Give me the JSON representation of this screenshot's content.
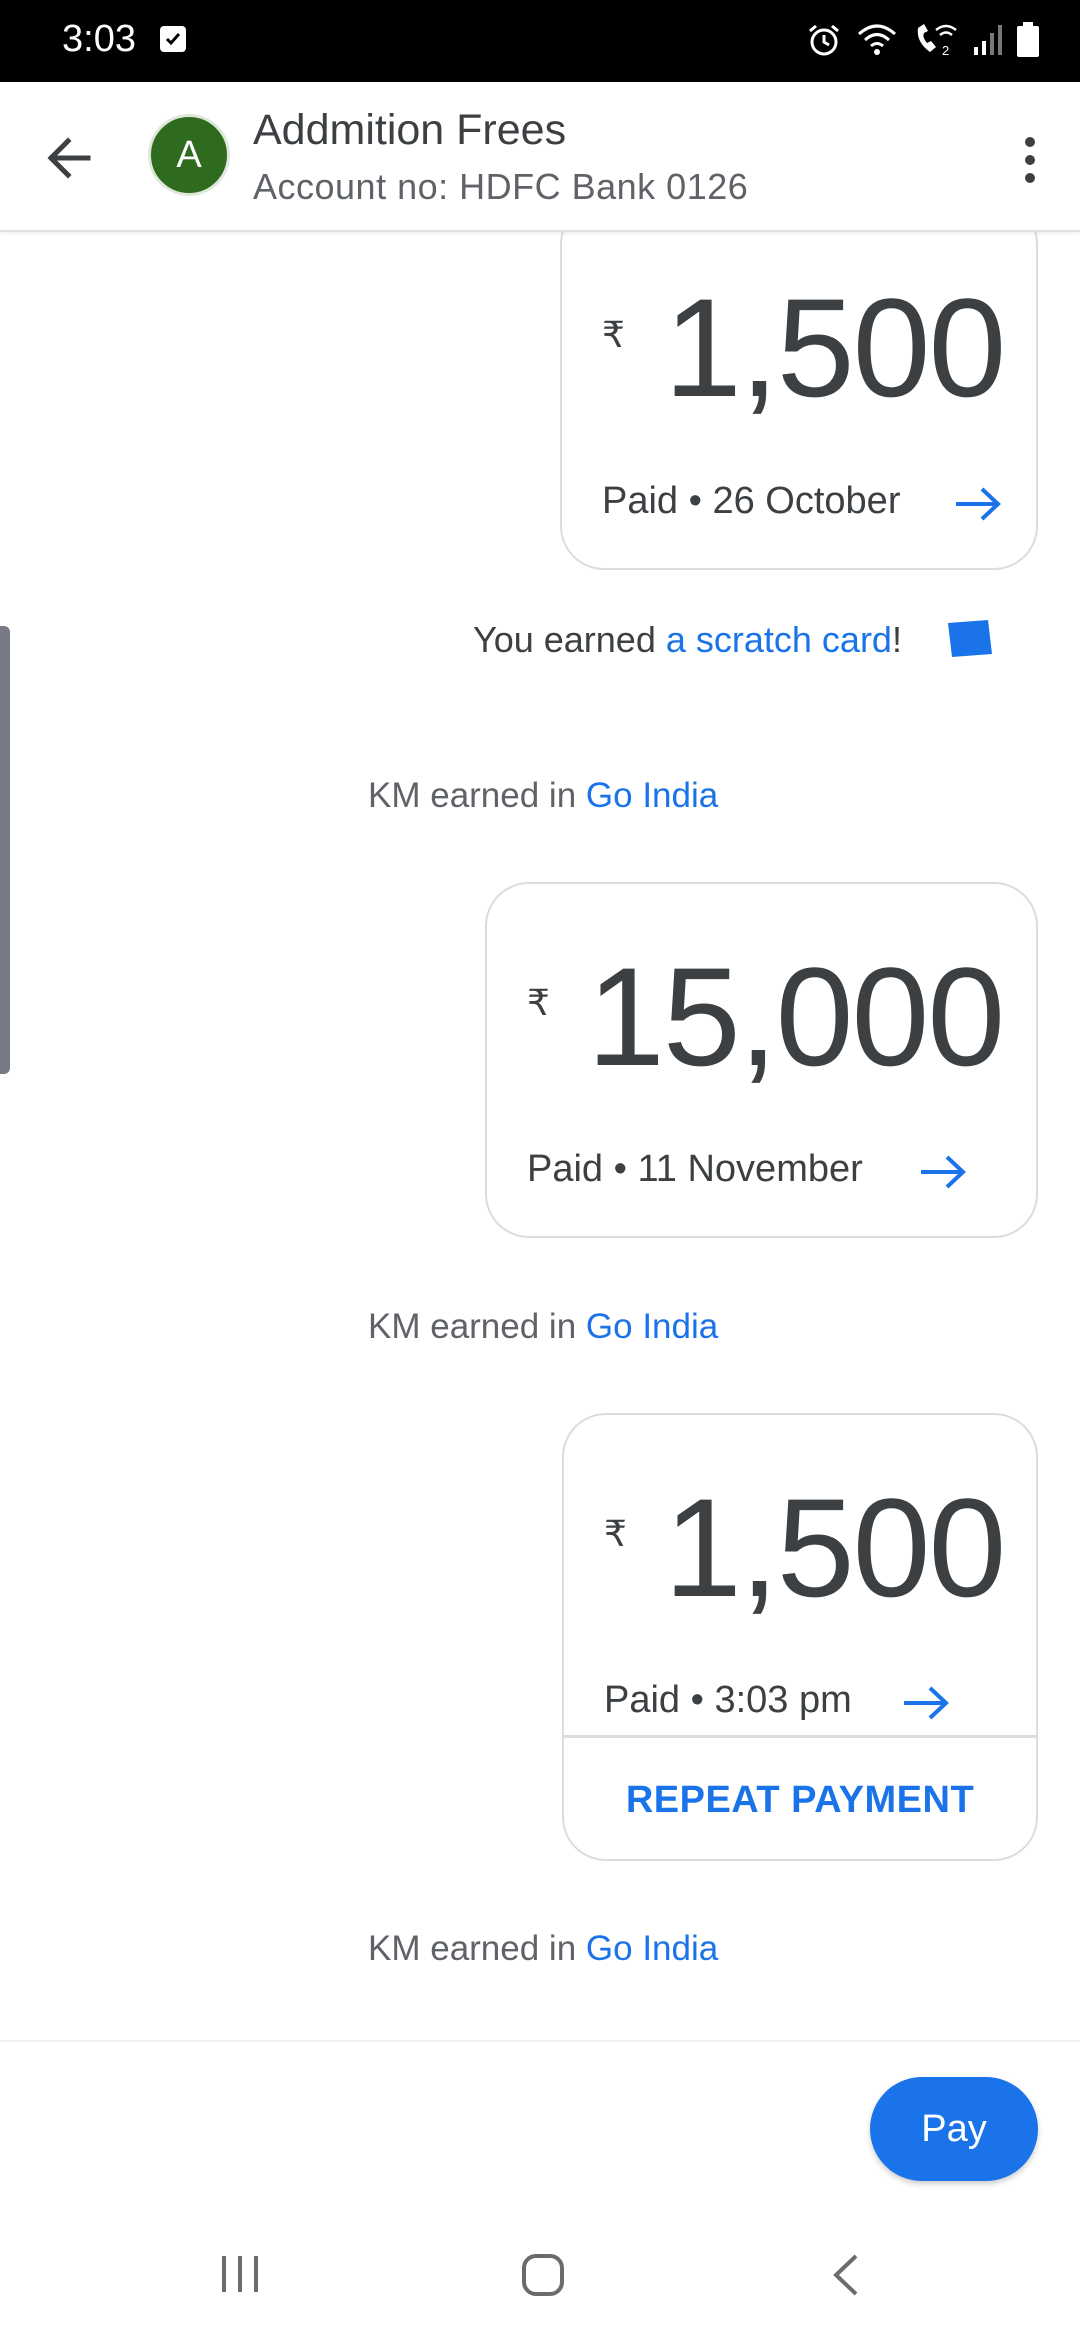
{
  "status_bar": {
    "time": "3:03",
    "icons": [
      "checkbox-notification-icon",
      "alarm-icon",
      "wifi-icon",
      "wifi-calling-icon",
      "signal-icon",
      "battery-icon"
    ]
  },
  "header": {
    "avatar_letter": "A",
    "title": "Addmition Frees",
    "subtitle": "Account no: HDFC Bank 0126"
  },
  "messages": [
    {
      "currency": "₹",
      "amount": "1,500",
      "status": "Paid • 26 October"
    },
    {
      "currency": "₹",
      "amount": "15,000",
      "status": "Paid • 11 November"
    },
    {
      "currency": "₹",
      "amount": "1,500",
      "status": "Paid • 3:03 pm",
      "action": "REPEAT PAYMENT"
    }
  ],
  "scratch_note": {
    "prefix": "You earned ",
    "link": "a scratch card",
    "suffix": "!"
  },
  "km_notes": [
    {
      "prefix": "KM earned in ",
      "link": "Go India"
    },
    {
      "prefix": "KM earned in ",
      "link": "Go India"
    },
    {
      "prefix": "KM earned in ",
      "link": "Go India"
    }
  ],
  "pay_button": "Pay",
  "colors": {
    "accent": "#1a73e8",
    "avatar_bg": "#2e6b1f"
  }
}
